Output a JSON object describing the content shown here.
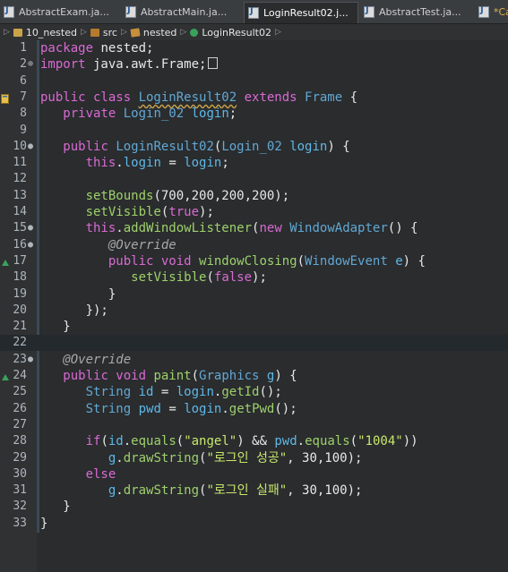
{
  "tabs": [
    {
      "label": "AbstractExam.ja...",
      "active": false
    },
    {
      "label": "AbstractMain.ja...",
      "active": false
    },
    {
      "label": "LoginResult02.j...",
      "active": true,
      "close": "×"
    },
    {
      "label": "AbstractTest.ja...",
      "active": false
    },
    {
      "label": "*Ca",
      "active": false
    }
  ],
  "breadcrumb": {
    "project": "10_nested",
    "folder": "src",
    "package": "nested",
    "class": "LoginResult02"
  },
  "editor": {
    "lines": [
      {
        "n": "1",
        "fold": "",
        "code": [
          [
            "kw",
            "package"
          ],
          [
            "plain",
            " nested;"
          ]
        ]
      },
      {
        "n": "2",
        "fold": "⊕",
        "code": [
          [
            "kw",
            "import"
          ],
          [
            "plain",
            " java.awt.Frame;"
          ]
        ],
        "box": true
      },
      {
        "n": "6",
        "fold": "",
        "code": []
      },
      {
        "n": "7",
        "fold": "",
        "marker": true,
        "code": [
          [
            "kw",
            "public class "
          ],
          [
            "ty ul",
            "LoginResult02"
          ],
          [
            "kw",
            " extends "
          ],
          [
            "ty",
            "Frame"
          ],
          [
            "plain",
            " {"
          ]
        ]
      },
      {
        "n": "8",
        "fold": "",
        "code": [
          [
            "plain",
            "   "
          ],
          [
            "kw",
            "private "
          ],
          [
            "ty",
            "Login_02"
          ],
          [
            "plain",
            " "
          ],
          [
            "fld",
            "login"
          ],
          [
            "plain",
            ";"
          ]
        ]
      },
      {
        "n": "9",
        "fold": "",
        "code": []
      },
      {
        "n": "10",
        "fold": "●",
        "code": [
          [
            "plain",
            "   "
          ],
          [
            "kw",
            "public "
          ],
          [
            "ty",
            "LoginResult02"
          ],
          [
            "plain",
            "("
          ],
          [
            "ty",
            "Login_02"
          ],
          [
            "plain",
            " "
          ],
          [
            "var",
            "login"
          ],
          [
            "plain",
            ") {"
          ]
        ]
      },
      {
        "n": "11",
        "fold": "",
        "code": [
          [
            "plain",
            "      "
          ],
          [
            "kw",
            "this"
          ],
          [
            "plain",
            "."
          ],
          [
            "fld",
            "login"
          ],
          [
            "plain",
            " = "
          ],
          [
            "var",
            "login"
          ],
          [
            "plain",
            ";"
          ]
        ]
      },
      {
        "n": "12",
        "fold": "",
        "code": []
      },
      {
        "n": "13",
        "fold": "",
        "code": [
          [
            "plain",
            "      "
          ],
          [
            "mth",
            "setBounds"
          ],
          [
            "plain",
            "(700,200,200,200);"
          ]
        ]
      },
      {
        "n": "14",
        "fold": "",
        "code": [
          [
            "plain",
            "      "
          ],
          [
            "mth",
            "setVisible"
          ],
          [
            "plain",
            "("
          ],
          [
            "kw",
            "true"
          ],
          [
            "plain",
            ");"
          ]
        ]
      },
      {
        "n": "15",
        "fold": "●",
        "code": [
          [
            "plain",
            "      "
          ],
          [
            "kw",
            "this"
          ],
          [
            "plain",
            "."
          ],
          [
            "mth",
            "addWindowListener"
          ],
          [
            "plain",
            "("
          ],
          [
            "kw",
            "new "
          ],
          [
            "ty",
            "WindowAdapter"
          ],
          [
            "plain",
            "() {"
          ]
        ]
      },
      {
        "n": "16",
        "fold": "●",
        "code": [
          [
            "plain",
            "         "
          ],
          [
            "ann",
            "@Override"
          ]
        ]
      },
      {
        "n": "17",
        "fold": "",
        "override": true,
        "code": [
          [
            "plain",
            "         "
          ],
          [
            "kw",
            "public void "
          ],
          [
            "mth",
            "windowClosing"
          ],
          [
            "plain",
            "("
          ],
          [
            "ty",
            "WindowEvent"
          ],
          [
            "plain",
            " "
          ],
          [
            "var",
            "e"
          ],
          [
            "plain",
            ") {"
          ]
        ]
      },
      {
        "n": "18",
        "fold": "",
        "code": [
          [
            "plain",
            "            "
          ],
          [
            "mth",
            "setVisible"
          ],
          [
            "plain",
            "("
          ],
          [
            "kw",
            "false"
          ],
          [
            "plain",
            ");"
          ]
        ]
      },
      {
        "n": "19",
        "fold": "",
        "code": [
          [
            "plain",
            "         }"
          ]
        ]
      },
      {
        "n": "20",
        "fold": "",
        "code": [
          [
            "plain",
            "      });"
          ]
        ]
      },
      {
        "n": "21",
        "fold": "",
        "code": [
          [
            "plain",
            "   }"
          ]
        ]
      },
      {
        "n": "22",
        "fold": "",
        "current": true,
        "code": []
      },
      {
        "n": "23",
        "fold": "●",
        "code": [
          [
            "plain",
            "   "
          ],
          [
            "ann",
            "@Override"
          ]
        ]
      },
      {
        "n": "24",
        "fold": "",
        "override": true,
        "code": [
          [
            "plain",
            "   "
          ],
          [
            "kw",
            "public void "
          ],
          [
            "mth",
            "paint"
          ],
          [
            "plain",
            "("
          ],
          [
            "ty",
            "Graphics"
          ],
          [
            "plain",
            " "
          ],
          [
            "var",
            "g"
          ],
          [
            "plain",
            ") {"
          ]
        ]
      },
      {
        "n": "25",
        "fold": "",
        "code": [
          [
            "plain",
            "      "
          ],
          [
            "ty",
            "String"
          ],
          [
            "plain",
            " "
          ],
          [
            "var",
            "id"
          ],
          [
            "plain",
            " = "
          ],
          [
            "fld",
            "login"
          ],
          [
            "plain",
            "."
          ],
          [
            "mth",
            "getId"
          ],
          [
            "plain",
            "();"
          ]
        ]
      },
      {
        "n": "26",
        "fold": "",
        "code": [
          [
            "plain",
            "      "
          ],
          [
            "ty",
            "String"
          ],
          [
            "plain",
            " "
          ],
          [
            "var",
            "pwd"
          ],
          [
            "plain",
            " = "
          ],
          [
            "fld",
            "login"
          ],
          [
            "plain",
            "."
          ],
          [
            "mth",
            "getPwd"
          ],
          [
            "plain",
            "();"
          ]
        ]
      },
      {
        "n": "27",
        "fold": "",
        "code": []
      },
      {
        "n": "28",
        "fold": "",
        "code": [
          [
            "plain",
            "      "
          ],
          [
            "kw",
            "if"
          ],
          [
            "plain",
            "("
          ],
          [
            "var",
            "id"
          ],
          [
            "plain",
            "."
          ],
          [
            "mth",
            "equals"
          ],
          [
            "plain",
            "("
          ],
          [
            "str",
            "\"angel\""
          ],
          [
            "plain",
            ") && "
          ],
          [
            "var",
            "pwd"
          ],
          [
            "plain",
            "."
          ],
          [
            "mth",
            "equals"
          ],
          [
            "plain",
            "("
          ],
          [
            "str",
            "\"1004\""
          ],
          [
            "plain",
            "))"
          ]
        ]
      },
      {
        "n": "29",
        "fold": "",
        "code": [
          [
            "plain",
            "         "
          ],
          [
            "var",
            "g"
          ],
          [
            "plain",
            "."
          ],
          [
            "mth",
            "drawString"
          ],
          [
            "plain",
            "("
          ],
          [
            "str",
            "\"로그인 성공\""
          ],
          [
            "plain",
            ", 30,100);"
          ]
        ]
      },
      {
        "n": "30",
        "fold": "",
        "code": [
          [
            "plain",
            "      "
          ],
          [
            "kw",
            "else"
          ]
        ]
      },
      {
        "n": "31",
        "fold": "",
        "code": [
          [
            "plain",
            "         "
          ],
          [
            "var",
            "g"
          ],
          [
            "plain",
            "."
          ],
          [
            "mth",
            "drawString"
          ],
          [
            "plain",
            "("
          ],
          [
            "str",
            "\"로그인 실패\""
          ],
          [
            "plain",
            ", 30,100);"
          ]
        ]
      },
      {
        "n": "32",
        "fold": "",
        "code": [
          [
            "plain",
            "   }"
          ]
        ]
      },
      {
        "n": "33",
        "fold": "",
        "code": [
          [
            "plain",
            "}"
          ]
        ]
      }
    ]
  }
}
